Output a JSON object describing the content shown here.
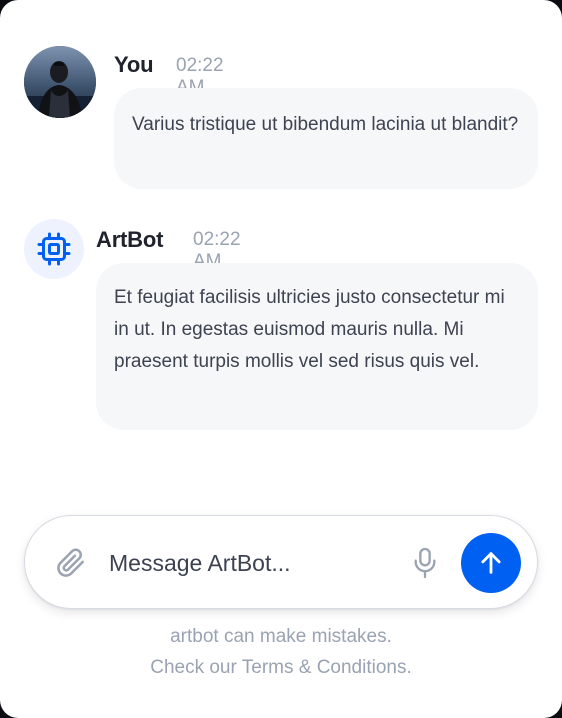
{
  "messages": [
    {
      "sender": "You",
      "time": "02:22 AM",
      "text": "Varius tristique ut bibendum lacinia ut blandit?",
      "avatar": "user-photo"
    },
    {
      "sender": "ArtBot",
      "time": "02:22 AM",
      "text": "Et feugiat facilisis ultricies justo consectetur mi in ut. In egestas euismod mauris nulla. Mi praesent turpis mollis vel sed risus quis vel.",
      "avatar": "chip-icon"
    }
  ],
  "composer": {
    "placeholder": "Message ArtBot...",
    "attach_icon": "paperclip-icon",
    "mic_icon": "microphone-icon",
    "send_icon": "arrow-up-icon"
  },
  "footer": {
    "line1": "artbot can make mistakes.",
    "line2": "Check our Terms & Conditions."
  },
  "colors": {
    "accent": "#0060f2",
    "bubble": "#f6f7f9",
    "bot_avatar_bg": "#eef2ff"
  }
}
